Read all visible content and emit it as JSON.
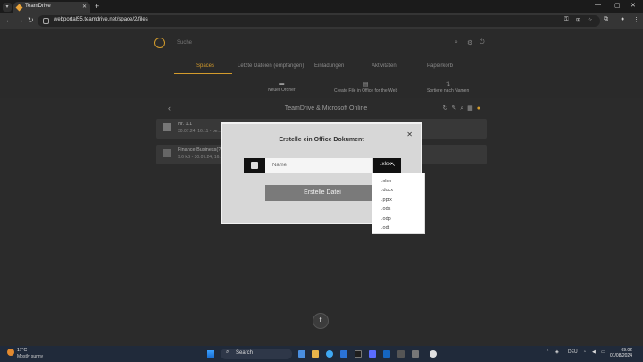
{
  "browser": {
    "tab_title": "TeamDrive",
    "url": "webportal55.teamdrive.net/space/2/files",
    "icons": [
      "chevron-down-icon",
      "tab-close-icon",
      "new-tab-icon",
      "back-icon",
      "forward-icon",
      "reload-icon",
      "site-info-icon",
      "star-icon",
      "extensions-icon",
      "profile-icon",
      "menu-icon"
    ]
  },
  "app": {
    "search_placeholder": "Suche",
    "nav_tabs": [
      {
        "label": "Spaces",
        "active": true
      },
      {
        "label": "Letzte Dateien (empfangen)",
        "active": false
      },
      {
        "label": "Einladungen",
        "active": false
      },
      {
        "label": "Aktivitäten",
        "active": false
      },
      {
        "label": "Papierkorb",
        "active": false
      }
    ],
    "actions": [
      {
        "label": "Neuer Ordner",
        "icon": "folder-plus-icon"
      },
      {
        "label": "Create File in Office for the Web",
        "icon": "office-file-icon"
      },
      {
        "label": "Sortiere nach Namen",
        "icon": "sort-icon"
      }
    ],
    "folder_title": "TeamDrive & Microsoft Online",
    "files": [
      {
        "name": "Nr. 1.1",
        "meta": "30.07.24, 16:11 - pe...",
        "icon": "folder-icon"
      },
      {
        "name": "Finance Business(?)",
        "meta": "9.6 kB - 30.07.24, 16:...",
        "icon": "document-icon"
      }
    ]
  },
  "dialog": {
    "title": "Erstelle ein Office Dokument",
    "name_placeholder": "Name",
    "selected_extension": ".xlsx",
    "create_button": "Erstelle Datei",
    "extension_options": [
      ".xlsx",
      ".docx",
      ".pptx",
      ".ods",
      ".odp",
      ".odt"
    ]
  },
  "taskbar": {
    "temperature": "17°C",
    "weather": "Mostly sunny",
    "search_label": "Search",
    "language": "DEU",
    "time": "09:02",
    "date": "01/08/2024"
  },
  "colors": {
    "accent": "#d39b2c",
    "dialog_bg": "#d7d7d7",
    "button_bg": "#7a7a7a",
    "taskbar_bg": "#202a3a"
  }
}
